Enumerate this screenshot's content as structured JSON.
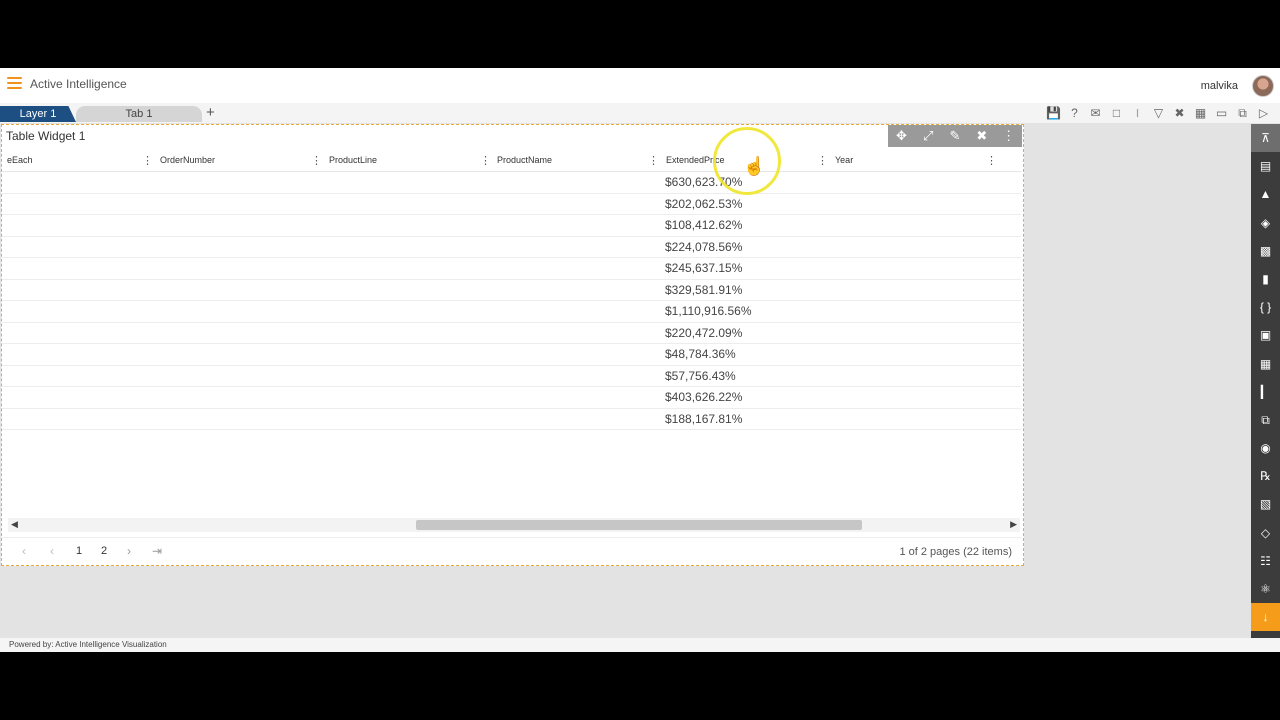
{
  "app": {
    "title": "Active Intelligence",
    "user": "malvika"
  },
  "tabs": {
    "layer_label": "Layer 1",
    "tab_label": "Tab 1",
    "add_label": "+"
  },
  "toolbar": {
    "icons": [
      "save-icon",
      "help-icon",
      "mail-icon",
      "comment-icon",
      "clear-filter-icon",
      "filter-icon",
      "tools-icon",
      "table-icon",
      "screen-icon",
      "copy-icon",
      "play-icon"
    ]
  },
  "widget": {
    "title": "Table Widget 1",
    "tool_icons": [
      "move-icon",
      "expand-icon",
      "edit-icon",
      "settings-icon",
      "more-icon"
    ],
    "columns": [
      "eEach",
      "OrderNumber",
      "ProductLine",
      "ProductName",
      "ExtendedPrice",
      "Year"
    ],
    "rows": [
      "$630,623.70%",
      "$202,062.53%",
      "$108,412.62%",
      "$224,078.56%",
      "$245,637.15%",
      "$329,581.91%",
      "$1,110,916.56%",
      "$220,472.09%",
      "$48,784.36%",
      "$57,756.43%",
      "$403,626.22%",
      "$188,167.81%"
    ],
    "pager": {
      "pages": [
        "1",
        "2"
      ],
      "info": "1 of 2 pages (22 items)"
    }
  },
  "sidebar": {
    "icons": [
      "collapse-up-icon",
      "list-icon",
      "chart-icon",
      "map-icon",
      "pdf-icon",
      "document-icon",
      "code-icon",
      "image-icon",
      "layout-icon",
      "bar-chart-icon",
      "copy-icon",
      "network-icon",
      "formula-icon",
      "report-icon",
      "layers-icon",
      "qr-icon",
      "alert-icon",
      "download-icon"
    ]
  },
  "footer": {
    "text": "Powered by: Active Intelligence Visualization"
  }
}
